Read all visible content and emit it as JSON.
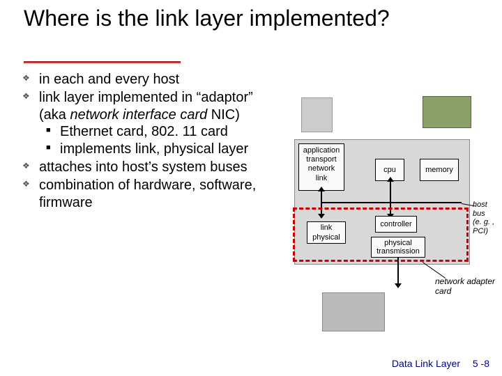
{
  "title": "Where is the link layer implemented?",
  "bullets": {
    "b1": "in each and every host",
    "b2_pre": "link layer implemented in “adaptor” (aka ",
    "b2_em": "network interface card",
    "b2_post": " NIC)",
    "b2_sub1": "Ethernet card, 802. 11 card",
    "b2_sub2": "implements link, physical layer",
    "b3": "attaches into host’s system buses",
    "b4": "combination of hardware, software, firmware"
  },
  "diagram": {
    "stack": {
      "l1": "application",
      "l2": "transport",
      "l3": "network",
      "l4": "link"
    },
    "cpu": "cpu",
    "memory": "memory",
    "linkphy": {
      "l1": "link",
      "l2": "physical"
    },
    "controller": "controller",
    "phystrans": {
      "l1": "physical",
      "l2": "transmission"
    },
    "hostbus": {
      "l1": "host",
      "l2": "bus",
      "l3": "(e. g. , PCI)"
    },
    "nac": {
      "l1": "network adapter",
      "l2": "card"
    }
  },
  "footer": {
    "section": "Data Link Layer",
    "page": "5 -8"
  }
}
